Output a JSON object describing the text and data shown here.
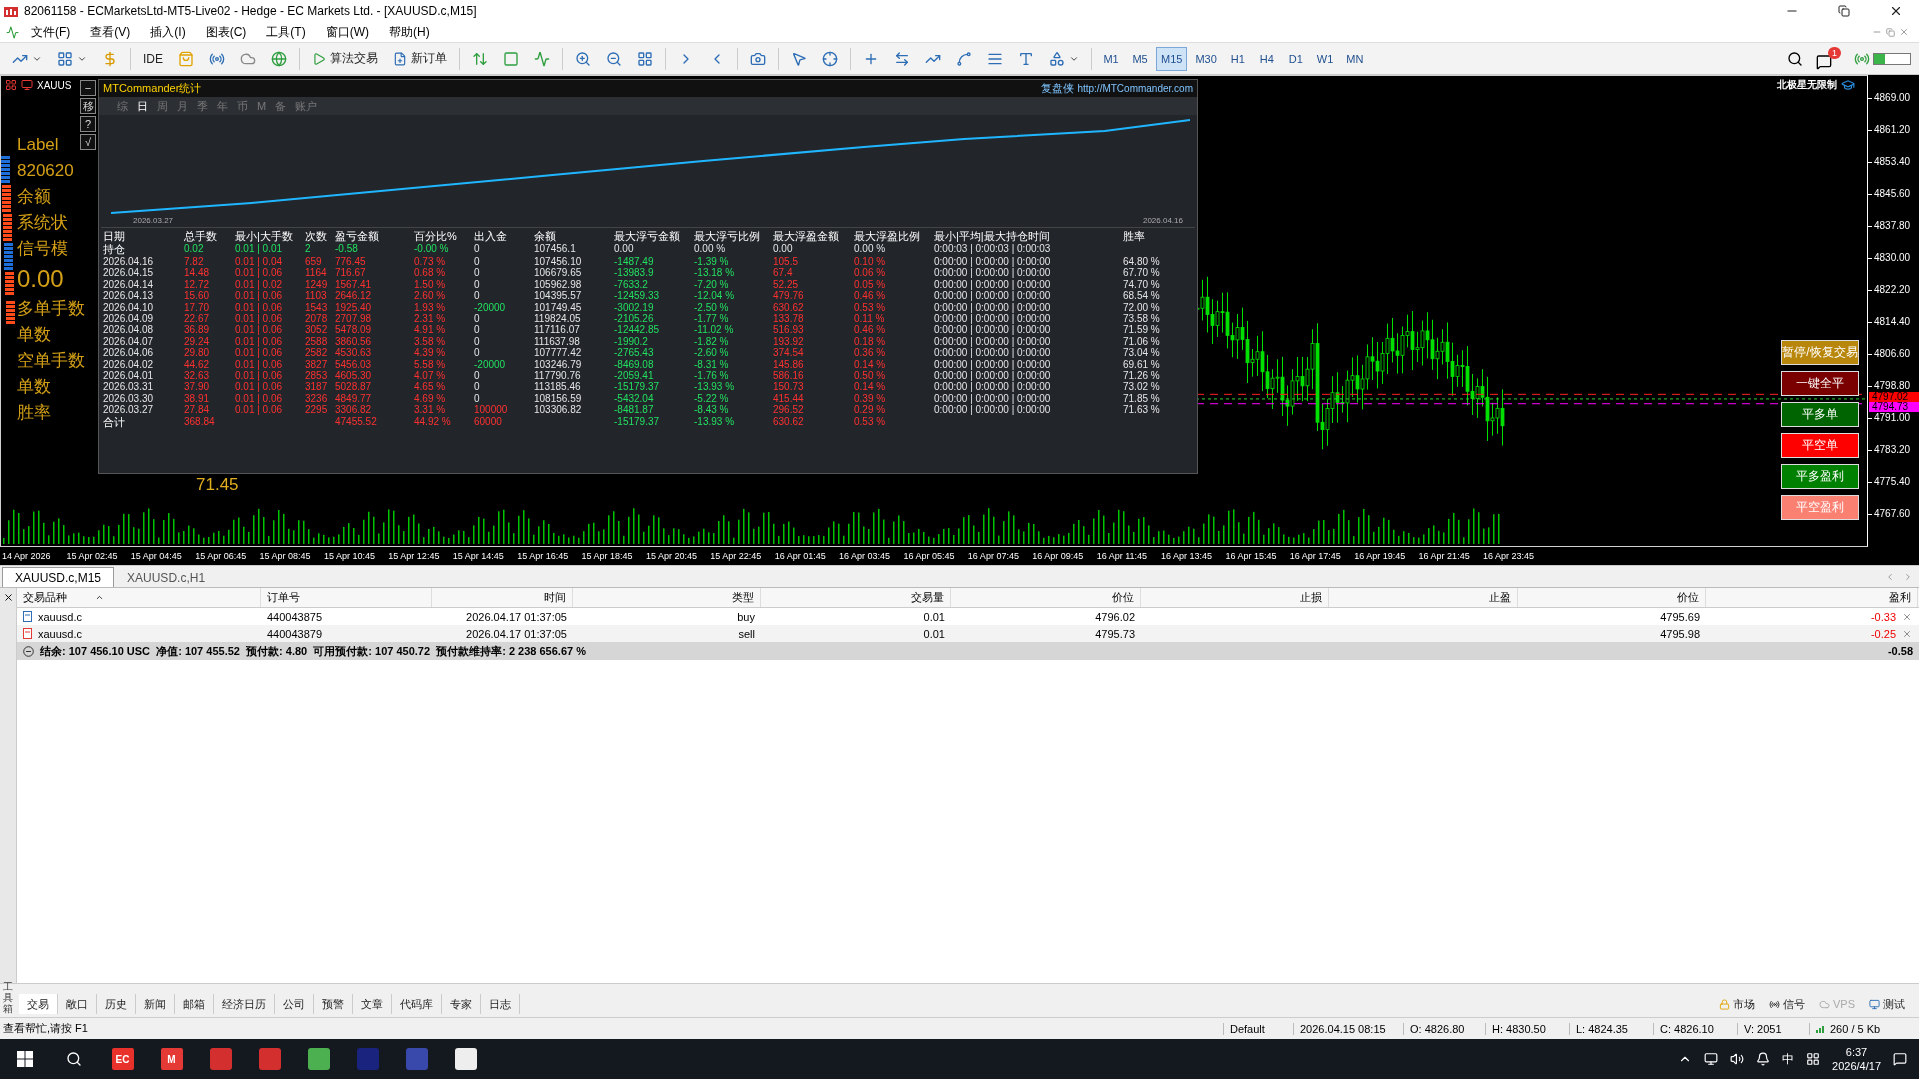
{
  "window": {
    "title": "82061158 - ECMarketsLtd-MT5-Live02 - Hedge - EC Markets Ltd. - [XAUUSD.c,M15]"
  },
  "menu": [
    "文件(F)",
    "查看(V)",
    "插入(I)",
    "图表(C)",
    "工具(T)",
    "窗口(W)",
    "帮助(H)"
  ],
  "toolbar": {
    "ide": "IDE",
    "algo_trading": "算法交易",
    "new_order": "新订单",
    "notifications": "1",
    "timeframes": [
      {
        "label": "M1",
        "selected": false
      },
      {
        "label": "M5",
        "selected": false
      },
      {
        "label": "M15",
        "selected": true
      },
      {
        "label": "M30",
        "selected": false
      },
      {
        "label": "H1",
        "selected": false
      },
      {
        "label": "H4",
        "selected": false
      },
      {
        "label": "D1",
        "selected": false
      },
      {
        "label": "W1",
        "selected": false
      },
      {
        "label": "MN",
        "selected": false
      }
    ]
  },
  "chart": {
    "symbol": "XAUUS",
    "corner_label": "北极星无限制",
    "tool_buttons": [
      "−",
      "移",
      "?",
      "√"
    ],
    "overlay_texts": [
      "Label",
      "820620",
      "余额",
      "系统状",
      "信号模",
      "0.00",
      "多单手数",
      "单数",
      "空单手数",
      "单数",
      "胜率"
    ],
    "win_rate_value": "71.45",
    "price_labels": [
      "4869.00",
      "4861.20",
      "4853.40",
      "4845.60",
      "4837.80",
      "4830.00",
      "4822.20",
      "4814.40",
      "4806.60",
      "4798.80",
      "4791.00",
      "4783.20",
      "4775.40",
      "4767.60"
    ],
    "ask_price": "4797.02",
    "bid_price": "4794.73",
    "time_labels": [
      "14 Apr 2026",
      "15 Apr 02:45",
      "15 Apr 04:45",
      "15 Apr 06:45",
      "15 Apr 08:45",
      "15 Apr 10:45",
      "15 Apr 12:45",
      "15 Apr 14:45",
      "15 Apr 16:45",
      "15 Apr 18:45",
      "15 Apr 20:45",
      "15 Apr 22:45",
      "16 Apr 01:45",
      "16 Apr 03:45",
      "16 Apr 05:45",
      "16 Apr 07:45",
      "16 Apr 09:45",
      "16 Apr 11:45",
      "16 Apr 13:45",
      "16 Apr 15:45",
      "16 Apr 17:45",
      "16 Apr 19:45",
      "16 Apr 21:45",
      "16 Apr 23:45"
    ],
    "buttons": [
      {
        "label": "暂停/恢复交易",
        "color": "#b8860b"
      },
      {
        "label": "一键全平",
        "color": "#7a0000"
      },
      {
        "label": "平多单",
        "color": "#006400"
      },
      {
        "label": "平空单",
        "color": "#ff0000"
      },
      {
        "label": "平多盈利",
        "color": "#008000"
      },
      {
        "label": "平空盈利",
        "color": "#fa8072"
      }
    ]
  },
  "stats_panel": {
    "title": "MTCommander统计",
    "link_label": "复盘侠",
    "link": "http://MTCommander.com",
    "tabs": [
      {
        "label": "综",
        "selected": false
      },
      {
        "label": "日",
        "selected": true
      },
      {
        "label": "周",
        "selected": false
      },
      {
        "label": "月",
        "selected": false
      },
      {
        "label": "季",
        "selected": false
      },
      {
        "label": "年",
        "selected": false
      },
      {
        "label": "币",
        "selected": false
      },
      {
        "label": "M",
        "selected": false
      },
      {
        "label": "备",
        "selected": false
      },
      {
        "label": "账户",
        "selected": false
      }
    ],
    "start_date": "2026.03.27",
    "end_date": "2026.04.16",
    "columns": [
      "日期",
      "总手数",
      "最小|大手数",
      "次数",
      "盈亏金额",
      "百分比%",
      "出入金",
      "余额",
      "最大浮亏金额",
      "最大浮亏比例",
      "最大浮盈金额",
      "最大浮盈比例",
      "最小|平均|最大持仓时间",
      "胜率"
    ],
    "rows": [
      {
        "kind": "holding",
        "cells": [
          "持仓",
          "0.02",
          "0.01 | 0.01",
          "2",
          "-0.58",
          "-0.00 %",
          "0",
          "107456.1",
          "0.00",
          "0.00 %",
          "0.00",
          "0.00 %",
          "0:00:03 | 0:00:03 | 0:00:03",
          null
        ]
      },
      {
        "kind": "day",
        "cells": [
          "2026.04.16",
          "7.82",
          "0.01 | 0.04",
          "659",
          "776.45",
          "0.73 %",
          "0",
          "107456.10",
          "-1487.49",
          "-1.39 %",
          "105.5",
          "0.10 %",
          "0:00:00 | 0:00:00 | 0:00:00",
          "64.80 %"
        ]
      },
      {
        "kind": "day",
        "cells": [
          "2026.04.15",
          "14.48",
          "0.01 | 0.06",
          "1164",
          "716.67",
          "0.68 %",
          "0",
          "106679.65",
          "-13983.9",
          "-13.18 %",
          "67.4",
          "0.06 %",
          "0:00:00 | 0:00:00 | 0:00:00",
          "67.70 %"
        ]
      },
      {
        "kind": "day",
        "cells": [
          "2026.04.14",
          "12.72",
          "0.01 | 0.02",
          "1249",
          "1567.41",
          "1.50 %",
          "0",
          "105962.98",
          "-7633.2",
          "-7.20 %",
          "52.25",
          "0.05 %",
          "0:00:00 | 0:00:00 | 0:00:00",
          "74.70 %"
        ]
      },
      {
        "kind": "day",
        "cells": [
          "2026.04.13",
          "15.60",
          "0.01 | 0.06",
          "1103",
          "2646.12",
          "2.60 %",
          "0",
          "104395.57",
          "-12459.33",
          "-12.04 %",
          "479.76",
          "0.46 %",
          "0:00:00 | 0:00:00 | 0:00:00",
          "68.54 %"
        ]
      },
      {
        "kind": "day",
        "cells": [
          "2026.04.10",
          "17.70",
          "0.01 | 0.06",
          "1543",
          "1925.40",
          "1.93 %",
          "-20000",
          "101749.45",
          "-3002.19",
          "-2.50 %",
          "630.62",
          "0.53 %",
          "0:00:00 | 0:00:00 | 0:00:00",
          "72.00 %"
        ]
      },
      {
        "kind": "day",
        "cells": [
          "2026.04.09",
          "22.67",
          "0.01 | 0.06",
          "2078",
          "2707.98",
          "2.31 %",
          "0",
          "119824.05",
          "-2105.26",
          "-1.77 %",
          "133.78",
          "0.11 %",
          "0:00:00 | 0:00:00 | 0:00:00",
          "73.58 %"
        ]
      },
      {
        "kind": "day",
        "cells": [
          "2026.04.08",
          "36.89",
          "0.01 | 0.06",
          "3052",
          "5478.09",
          "4.91 %",
          "0",
          "117116.07",
          "-12442.85",
          "-11.02 %",
          "516.93",
          "0.46 %",
          "0:00:00 | 0:00:00 | 0:00:00",
          "71.59 %"
        ]
      },
      {
        "kind": "day",
        "cells": [
          "2026.04.07",
          "29.24",
          "0.01 | 0.06",
          "2588",
          "3860.56",
          "3.58 %",
          "0",
          "111637.98",
          "-1990.2",
          "-1.82 %",
          "193.92",
          "0.18 %",
          "0:00:00 | 0:00:00 | 0:00:00",
          "71.06 %"
        ]
      },
      {
        "kind": "day",
        "cells": [
          "2026.04.06",
          "29.80",
          "0.01 | 0.06",
          "2582",
          "4530.63",
          "4.39 %",
          "0",
          "107777.42",
          "-2765.43",
          "-2.60 %",
          "374.54",
          "0.36 %",
          "0:00:00 | 0:00:00 | 0:00:00",
          "73.04 %"
        ]
      },
      {
        "kind": "day",
        "cells": [
          "2026.04.02",
          "44.62",
          "0.01 | 0.06",
          "3827",
          "5456.03",
          "5.58 %",
          "-20000",
          "103246.79",
          "-8469.08",
          "-8.31 %",
          "145.86",
          "0.14 %",
          "0:00:00 | 0:00:00 | 0:00:00",
          "69.61 %"
        ]
      },
      {
        "kind": "day",
        "cells": [
          "2026.04.01",
          "32.63",
          "0.01 | 0.06",
          "2853",
          "4605.30",
          "4.07 %",
          "0",
          "117790.76",
          "-2059.41",
          "-1.76 %",
          "586.16",
          "0.50 %",
          "0:00:00 | 0:00:00 | 0:00:00",
          "71.26 %"
        ]
      },
      {
        "kind": "day",
        "cells": [
          "2026.03.31",
          "37.90",
          "0.01 | 0.06",
          "3187",
          "5028.87",
          "4.65 %",
          "0",
          "113185.46",
          "-15179.37",
          "-13.93 %",
          "150.73",
          "0.14 %",
          "0:00:00 | 0:00:00 | 0:00:00",
          "73.02 %"
        ]
      },
      {
        "kind": "day",
        "cells": [
          "2026.03.30",
          "38.91",
          "0.01 | 0.06",
          "3236",
          "4849.77",
          "4.69 %",
          "0",
          "108156.59",
          "-5432.04",
          "-5.22 %",
          "415.44",
          "0.39 %",
          "0:00:00 | 0:00:00 | 0:00:00",
          "71.85 %"
        ]
      },
      {
        "kind": "day",
        "cells": [
          "2026.03.27",
          "27.84",
          "0.01 | 0.06",
          "2295",
          "3306.82",
          "3.31 %",
          "100000",
          "103306.82",
          "-8481.87",
          "-8.43 %",
          "296.52",
          "0.29 %",
          "0:00:00 | 0:00:00 | 0:00:00",
          "71.63 %"
        ]
      },
      {
        "kind": "total",
        "cells": [
          "合计",
          "368.84",
          null,
          null,
          "47455.52",
          "44.92 %",
          "60000",
          null,
          "-15179.37",
          "-13.93 %",
          "630.62",
          "0.53 %",
          null,
          null
        ]
      }
    ]
  },
  "chart_tabs": [
    {
      "label": "XAUUSD.c,M15",
      "selected": true
    },
    {
      "label": "XAUUSD.c,H1",
      "selected": false
    }
  ],
  "positions": {
    "columns": [
      "交易品种",
      "订单号",
      "时间",
      "类型",
      "交易量",
      "价位",
      "止损",
      "止盈",
      "价位",
      "盈利"
    ],
    "rows": [
      {
        "kind": "buy",
        "cells": [
          "xauusd.c",
          "440043875",
          "2026.04.17 01:37:05",
          "buy",
          "0.01",
          "4796.02",
          null,
          null,
          "4795.69",
          "-0.33"
        ]
      },
      {
        "kind": "sell",
        "cells": [
          "xauusd.c",
          "440043879",
          "2026.04.17 01:37:05",
          "sell",
          "0.01",
          "4795.73",
          null,
          null,
          "4795.98",
          "-0.25"
        ]
      }
    ],
    "summary": "结余: 107 456.10 USC  净值: 107 455.52  预付款: 4.80  可用预付款: 107 450.72  预付款维持率: 2 238 656.67 %",
    "summary_profit": "-0.58"
  },
  "toolbox_label": "工具箱",
  "bottom_tabs": [
    {
      "label": "交易",
      "selected": true
    },
    {
      "label": "敞口",
      "selected": false
    },
    {
      "label": "历史",
      "selected": false
    },
    {
      "label": "新闻",
      "selected": false
    },
    {
      "label": "邮箱",
      "selected": false
    },
    {
      "label": "经济日历",
      "selected": false
    },
    {
      "label": "公司",
      "selected": false
    },
    {
      "label": "预警",
      "selected": false
    },
    {
      "label": "文章",
      "selected": false
    },
    {
      "label": "代码库",
      "selected": false
    },
    {
      "label": "专家",
      "selected": false
    },
    {
      "label": "日志",
      "selected": false
    }
  ],
  "services": [
    {
      "label": "市场",
      "disabled": false
    },
    {
      "label": "信号",
      "disabled": false
    },
    {
      "label": "VPS",
      "disabled": true
    },
    {
      "label": "测试",
      "disabled": false
    }
  ],
  "status_bar": {
    "help": "查看帮忙,请按 F1",
    "profile": "Default",
    "datetime": "2026.04.15 08:15",
    "open": "O: 4826.80",
    "high": "H: 4830.50",
    "low": "L: 4824.35",
    "close": "C: 4826.10",
    "volume": "V: 2051",
    "traffic": "260 / 5 Kb"
  },
  "taskbar": {
    "apps": [
      {
        "kind": "label",
        "label": "EC",
        "color": "#e8312a"
      },
      {
        "kind": "label",
        "label": "M",
        "color": "#e53935"
      },
      {
        "kind": "icon",
        "color": "#d32f2f"
      },
      {
        "kind": "icon",
        "color": "#d32f2f"
      },
      {
        "kind": "icon",
        "color": "#4caf50"
      },
      {
        "kind": "icon",
        "color": "#1a237e"
      },
      {
        "kind": "icon",
        "color": "#3949ab"
      },
      {
        "kind": "icon",
        "color": "#eeeeee"
      }
    ],
    "ime": "中",
    "time": "6:37",
    "date": "2026/4/17"
  }
}
